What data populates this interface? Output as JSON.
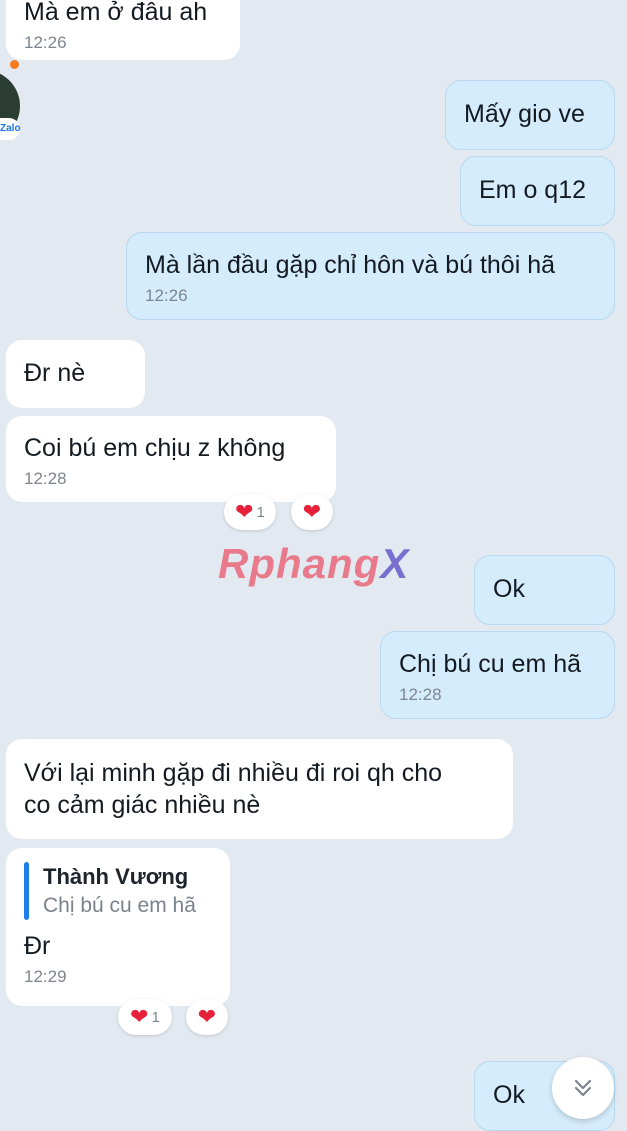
{
  "messages": {
    "m1": {
      "text": "Mà em ở đâu ah",
      "time": "12:26"
    },
    "m2": {
      "text": "Mấy gio ve"
    },
    "m3": {
      "text": "Em o q12"
    },
    "m4": {
      "text": "Mà lần đầu gặp chỉ hôn và bú thôi hã",
      "time": "12:26"
    },
    "m5": {
      "text": "Đr nè"
    },
    "m6": {
      "text": "Coi bú em chịu z không",
      "time": "12:28"
    },
    "m7": {
      "text": "Ok"
    },
    "m8": {
      "text": "Chị bú cu em hã",
      "time": "12:28"
    },
    "m9": {
      "line1": "Với lại minh gặp đi nhiều đi roi qh cho",
      "line2": "co cảm giác nhiều nè"
    },
    "m10": {
      "quote_name": "Thành Vương",
      "quote_text": "Chị bú cu em hã",
      "text": "Đr",
      "time": "12:29"
    },
    "m11": {
      "text": "Ok"
    }
  },
  "reactions": {
    "r1": {
      "count": "1"
    },
    "r2": {
      "count": "1"
    }
  },
  "avatar": {
    "badge": "Zalo"
  },
  "watermark": {
    "main": "Rphang",
    "tail": "X"
  },
  "icons": {
    "heart": "❤",
    "scroll_down": "double-chevron-down-icon"
  },
  "colors": {
    "incoming": "#ffffff",
    "outgoing": "#d4ecfc",
    "background": "#e2e9f1",
    "heart": "#e8213a"
  }
}
